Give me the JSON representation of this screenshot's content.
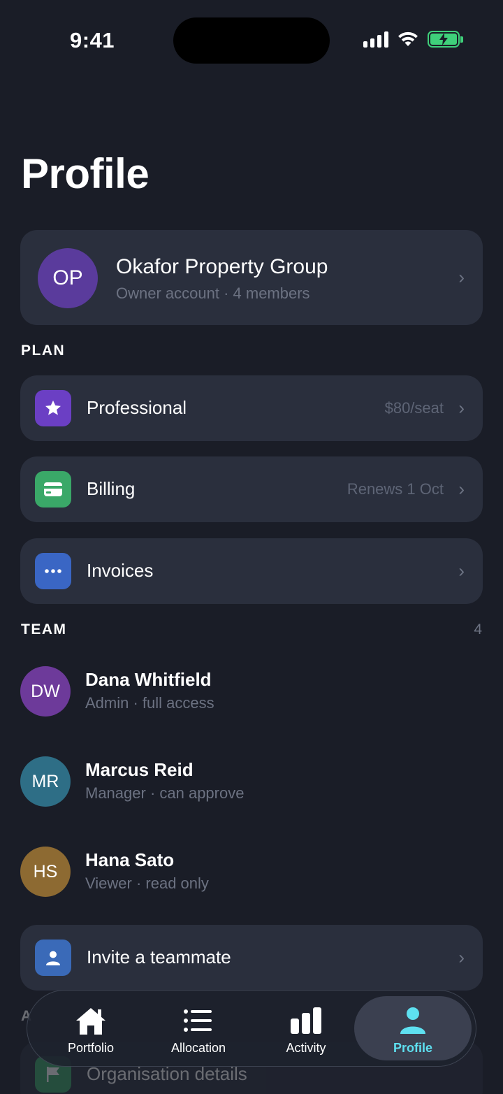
{
  "status_bar": {
    "time": "9:41"
  },
  "page": {
    "title": "Profile"
  },
  "account": {
    "initials": "OP",
    "name": "Okafor Property Group",
    "subtitle": "Owner account · 4 members"
  },
  "plan": {
    "section_label": "PLAN",
    "items": [
      {
        "label": "Professional",
        "value": "$80/seat",
        "icon": "star-icon",
        "color": "#6b3fc4"
      },
      {
        "label": "Billing",
        "value": "Renews 1 Oct",
        "icon": "credit-card-icon",
        "color": "#3aa868"
      },
      {
        "label": "Invoices",
        "value": "",
        "icon": "more-dots-icon",
        "color": "#3a66c4"
      }
    ]
  },
  "team": {
    "section_label": "TEAM",
    "count": "4",
    "members": [
      {
        "initials": "DW",
        "name": "Dana Whitfield",
        "role": "Admin · full access",
        "color": "#6d3a9a"
      },
      {
        "initials": "MR",
        "name": "Marcus Reid",
        "role": "Manager · can approve",
        "color": "#2e6e86"
      },
      {
        "initials": "HS",
        "name": "Hana Sato",
        "role": "Viewer · read only",
        "color": "#8d6a32"
      }
    ],
    "invite_label": "Invite a teammate"
  },
  "account_section": {
    "section_label": "A",
    "item_label": "Organisation details"
  },
  "tabbar": {
    "tabs": [
      {
        "label": "Portfolio",
        "icon": "home-icon"
      },
      {
        "label": "Allocation",
        "icon": "list-icon"
      },
      {
        "label": "Activity",
        "icon": "bar-chart-icon"
      },
      {
        "label": "Profile",
        "icon": "person-icon"
      }
    ],
    "active_color": "#5ee0f0"
  }
}
